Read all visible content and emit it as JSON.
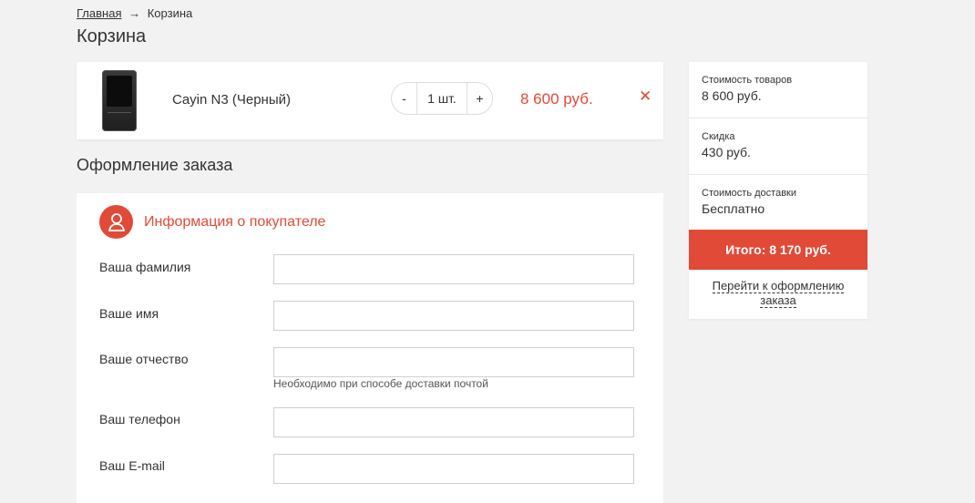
{
  "breadcrumb": {
    "home": "Главная",
    "separator": "→",
    "current": "Корзина"
  },
  "page_title": "Корзина",
  "cart": {
    "items": [
      {
        "name": "Cayin N3 (Черный)",
        "qty_minus": "-",
        "qty_value": "1 шт.",
        "qty_plus": "+",
        "price": "8 600 руб.",
        "remove": "✕"
      }
    ]
  },
  "order": {
    "section_title": "Оформление заказа",
    "buyer_info_title": "Информация о покупателе",
    "fields": {
      "lastname_label": "Ваша фамилия",
      "firstname_label": "Ваше имя",
      "patronymic_label": "Ваше отчество",
      "patronymic_hint": "Необходимо при способе доставки почтой",
      "phone_label": "Ваш телефон",
      "email_label": "Ваш E-mail"
    }
  },
  "summary": {
    "goods_label": "Стоимость товаров",
    "goods_value": "8 600 руб.",
    "discount_label": "Скидка",
    "discount_value": "430 руб.",
    "delivery_label": "Стоимость доставки",
    "delivery_value": "Бесплатно",
    "total": "Итого: 8 170 руб.",
    "checkout_link": "Перейти к оформлению заказа"
  },
  "colors": {
    "accent": "#e14a37",
    "background": "#f2f2f2"
  },
  "icons": {
    "remove": "close-icon",
    "buyer_info": "user-icon"
  }
}
